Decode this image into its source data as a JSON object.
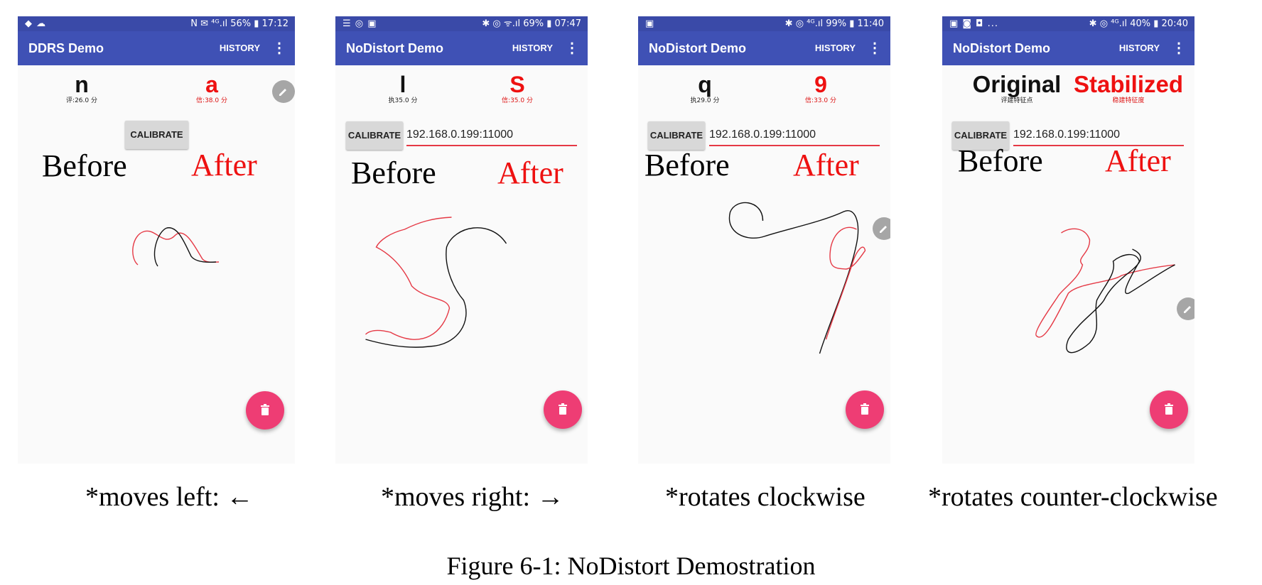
{
  "panels": [
    {
      "status_left": "◆ ☁",
      "status_right": "N ✉ ⁴ᴳ.ıl 56% ▮ 17:12",
      "app_title": "DDRS Demo",
      "history_label": "HISTORY",
      "menu_glyph": "⋮",
      "symbol_before": "n",
      "symbol_after": "a",
      "score_before": "评:26.0 分",
      "score_after": "信:38.0 分",
      "calibrate_label": "CALIBRATE",
      "ip_value": "",
      "before_label": "Before",
      "after_label": "After",
      "caption": "*moves left: ←",
      "icons": [
        "status-icons",
        "more-vert-icon",
        "edit-pencil-icon",
        "trash-icon"
      ]
    },
    {
      "status_left": "☰ ◎ ▣",
      "status_right": "✱ ◎ ᯤ.ıl 69% ▮ 07:47",
      "app_title": "NoDistort Demo",
      "history_label": "HISTORY",
      "menu_glyph": "⋮",
      "symbol_before": "l",
      "symbol_after": "S",
      "score_before": "执35.0 分",
      "score_after": "信:35.0 分",
      "calibrate_label": "CALIBRATE",
      "ip_value": "192.168.0.199:11000",
      "before_label": "Before",
      "after_label": "After",
      "caption": "*moves right: →",
      "icons": [
        "status-icons",
        "more-vert-icon",
        "trash-icon"
      ]
    },
    {
      "status_left": "▣",
      "status_right": "✱ ◎ ⁴ᴳ.ıl 99% ▮ 11:40",
      "app_title": "NoDistort Demo",
      "history_label": "HISTORY",
      "menu_glyph": "⋮",
      "symbol_before": "q",
      "symbol_after": "9",
      "score_before": "执29.0 分",
      "score_after": "信:33.0 分",
      "calibrate_label": "CALIBRATE",
      "ip_value": "192.168.0.199:11000",
      "before_label": "Before",
      "after_label": "After",
      "caption": "*rotates clockwise",
      "icons": [
        "status-icons",
        "more-vert-icon",
        "edit-pencil-icon",
        "trash-icon"
      ]
    },
    {
      "status_left": "▣ ◙ ◘ ...",
      "status_right": "✱ ◎ ⁴ᴳ.ıl 40% ▮ 20:40",
      "app_title": "NoDistort Demo",
      "history_label": "HISTORY",
      "menu_glyph": "⋮",
      "symbol_before": "Original",
      "symbol_after": "Stabilized",
      "score_before": "评建特征点",
      "score_after": "稳建特征度",
      "calibrate_label": "CALIBRATE",
      "ip_value": "192.168.0.199:11000",
      "before_label": "Before",
      "after_label": "After",
      "caption": "*rotates counter-clockwise",
      "icons": [
        "status-icons",
        "more-vert-icon",
        "edit-pencil-icon",
        "trash-icon"
      ]
    }
  ],
  "figure_caption": "Figure 6-1: NoDistort Demostration",
  "colors": {
    "app_bar": "#3f51b5",
    "status_bar": "#3a4aa8",
    "after_red": "#ee1111",
    "fab_pink": "#ee3d74",
    "stroke_before": "#111111",
    "stroke_after": "#e53945"
  }
}
